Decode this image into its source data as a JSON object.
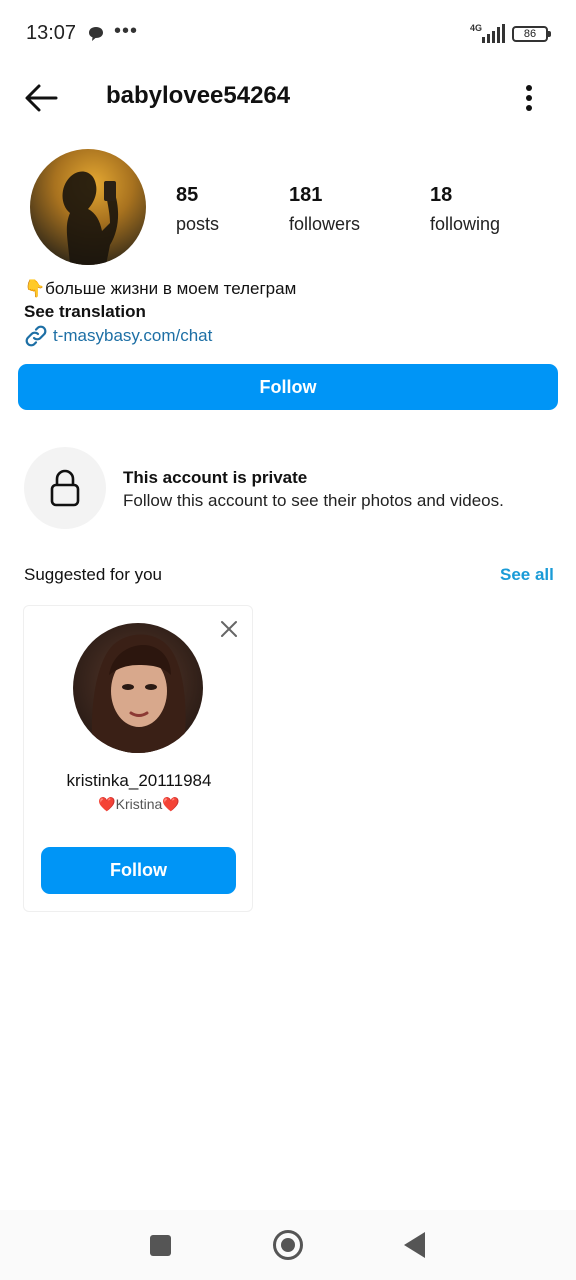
{
  "status_bar": {
    "time": "13:07",
    "dots": "•••",
    "network": "4G",
    "battery": "86",
    "icons": [
      "chat-bubble-icon",
      "signal-icon",
      "battery-icon"
    ]
  },
  "header": {
    "username": "babylovee54264",
    "icons": [
      "back-arrow-icon",
      "more-vertical-icon"
    ]
  },
  "profile": {
    "stats": [
      {
        "num": "85",
        "label": "posts"
      },
      {
        "num": "181",
        "label": "followers"
      },
      {
        "num": "18",
        "label": "following"
      }
    ],
    "bio": "👇больше жизни в моем телеграм",
    "see_translation": "See translation",
    "link": "t-masybasy.com/chat",
    "follow_label": "Follow"
  },
  "private": {
    "title": "This account is private",
    "description": "Follow this account to see their photos and videos."
  },
  "suggested": {
    "title": "Suggested for you",
    "see_all": "See all",
    "cards": [
      {
        "username": "kristinka_20111984",
        "name": "❤️Kristina❤️",
        "follow_label": "Follow"
      }
    ]
  },
  "colors": {
    "accent": "#0095f6",
    "link": "#1d6fa5",
    "see_all": "#1a9bd7"
  }
}
